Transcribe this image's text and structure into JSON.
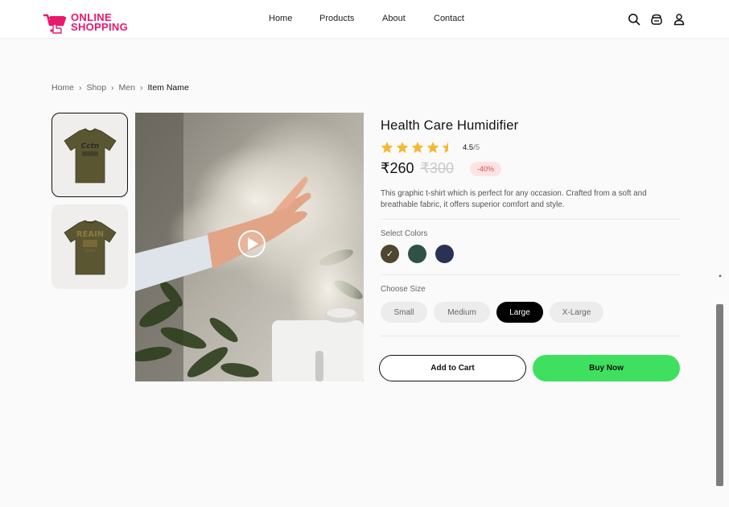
{
  "brand": {
    "line1": "ONLINE",
    "line2": "SHOPPING"
  },
  "nav": {
    "items": [
      {
        "label": "Home"
      },
      {
        "label": "Products"
      },
      {
        "label": "About"
      },
      {
        "label": "Contact"
      }
    ]
  },
  "header_icons": [
    "search-icon",
    "cart-icon",
    "user-icon"
  ],
  "breadcrumb": {
    "items": [
      "Home",
      "Shop",
      "Men"
    ],
    "current": "Item Name"
  },
  "product": {
    "title": "Health Care Humidifier",
    "rating": {
      "value": "4.5",
      "max": "/5",
      "stars": 4.5
    },
    "price": "₹260",
    "old_price": "₹300",
    "discount": "-40%",
    "description": "This graphic t-shirt which is perfect for any occasion. Crafted from a soft and breathable fabric, it offers superior comfort and style.",
    "colors_label": "Select Colors",
    "colors": [
      "#4f4630",
      "#2f5148",
      "#2a3155"
    ],
    "selected_color_index": 0,
    "size_label": "Choose Size",
    "sizes": [
      "Small",
      "Medium",
      "Large",
      "X-Large"
    ],
    "selected_size": "Large",
    "add_to_cart": "Add to Cart",
    "buy_now": "Buy Now"
  },
  "theme": {
    "brand": "#e8186d",
    "buy": "#3fe060",
    "discount_bg": "#fde4e4",
    "discount_fg": "#e64545"
  }
}
